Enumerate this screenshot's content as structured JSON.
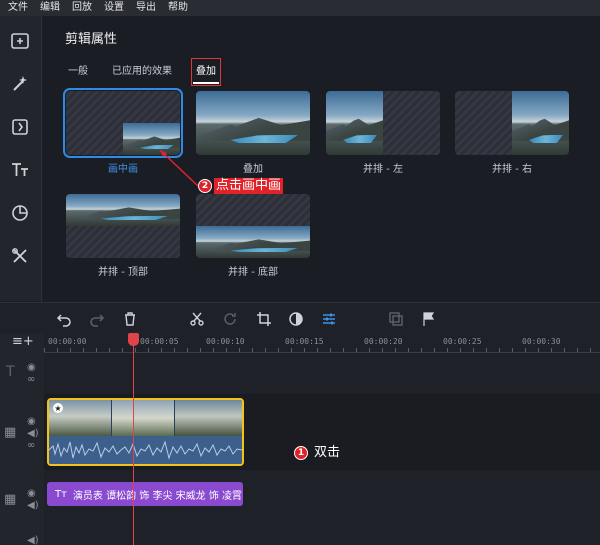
{
  "menu": [
    "文件",
    "编辑",
    "回放",
    "设置",
    "导出",
    "帮助"
  ],
  "panel": {
    "title": "剪辑属性",
    "tabs": [
      {
        "label": "一般",
        "active": false
      },
      {
        "label": "已应用的效果",
        "active": false
      },
      {
        "label": "叠加",
        "active": true
      }
    ],
    "overlays": [
      {
        "label": "画中画",
        "selected": true
      },
      {
        "label": "叠加",
        "selected": false
      },
      {
        "label": "并排 - 左",
        "selected": false
      },
      {
        "label": "并排 - 右",
        "selected": false
      },
      {
        "label": "并排 - 顶部",
        "selected": false
      },
      {
        "label": "并排 - 底部",
        "selected": false
      }
    ]
  },
  "annotations": {
    "step2_num": "2",
    "step2_text": "点击画中画",
    "step1_num": "1",
    "step1_text": "双击"
  },
  "timeline": {
    "ruler": [
      "00:00:00",
      "00:00:05",
      "00:00:10",
      "00:00:15",
      "00:00:20",
      "00:00:25",
      "00:00:30"
    ],
    "title_clip_icon": "Tт",
    "title_clip_text": "演员表 谭松韵 饰 李尖 宋威龙 饰 凌霄"
  },
  "colors": {
    "accent_blue": "#2f8be6",
    "annotation_red": "#e0232a",
    "clip_border": "#f0c419",
    "title_clip": "#8a4ad0",
    "playhead": "#e0444a"
  }
}
